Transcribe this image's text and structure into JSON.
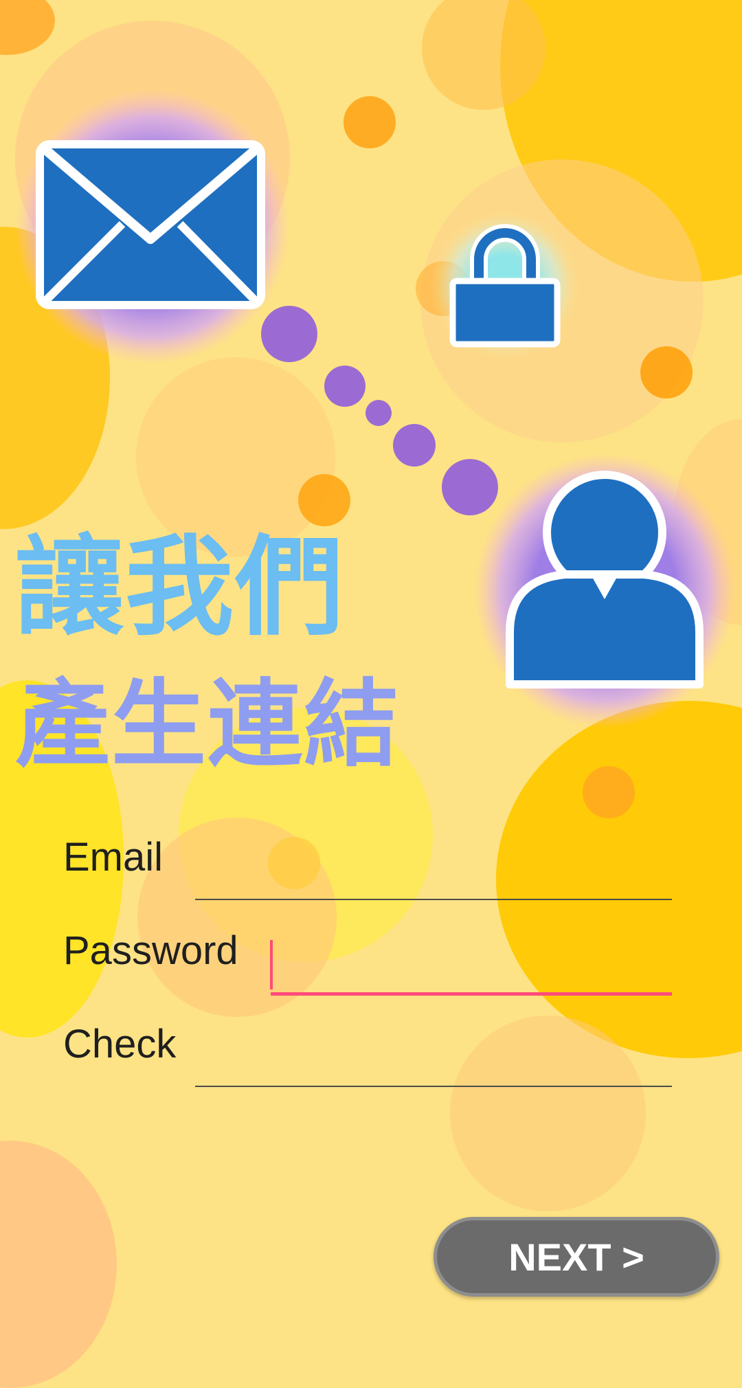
{
  "headline": {
    "line1": "讓我們",
    "line2": "產生連結"
  },
  "form": {
    "email": {
      "label": "Email",
      "value": "",
      "placeholder": ""
    },
    "password": {
      "label": "Password",
      "value": "",
      "placeholder": "",
      "focused": true
    },
    "check": {
      "label": "Check",
      "value": "",
      "placeholder": ""
    }
  },
  "next_button": {
    "label": "NEXT >"
  },
  "icons": {
    "hero_mail": "mail-envelope-icon",
    "hero_lock": "padlock-icon",
    "hero_user": "user-profile-icon"
  },
  "colors": {
    "background": "#fde385",
    "headline_line1": "#6bbdf2",
    "headline_line2": "#8e9df0",
    "icon_blue": "#1f6fc0",
    "accent_purple": "#9b6bd3",
    "focus_underline": "#ff4c7a",
    "button_bg": "#6b6b6b"
  }
}
